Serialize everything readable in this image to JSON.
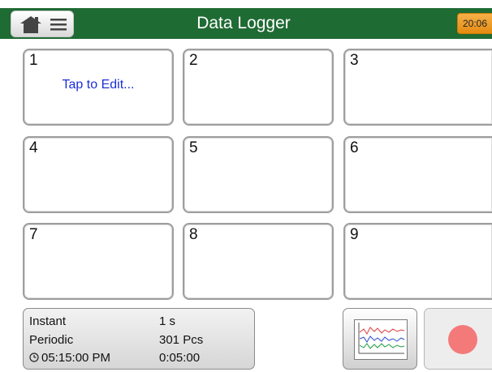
{
  "header": {
    "title": "Data Logger",
    "time": "20:06",
    "color": "#1f6b34"
  },
  "grid": {
    "cells": [
      {
        "number": "1",
        "hint": "Tap to Edit..."
      },
      {
        "number": "2"
      },
      {
        "number": "3"
      },
      {
        "number": "4"
      },
      {
        "number": "5"
      },
      {
        "number": "6"
      },
      {
        "number": "7"
      },
      {
        "number": "8"
      },
      {
        "number": "9"
      }
    ]
  },
  "status": {
    "instant_label": "Instant",
    "instant_value": "1 s",
    "periodic_label": "Periodic",
    "periodic_value": "301 Pcs",
    "start_time": "05:15:00 PM",
    "duration": "0:05:00"
  },
  "icons": {
    "home": "home-icon",
    "menu": "menu-icon",
    "clock": "clock-icon",
    "graph": "graph-icon",
    "record": "record-icon"
  },
  "colors": {
    "hint_text": "#1b2fd8",
    "record": "#f47a7a"
  }
}
